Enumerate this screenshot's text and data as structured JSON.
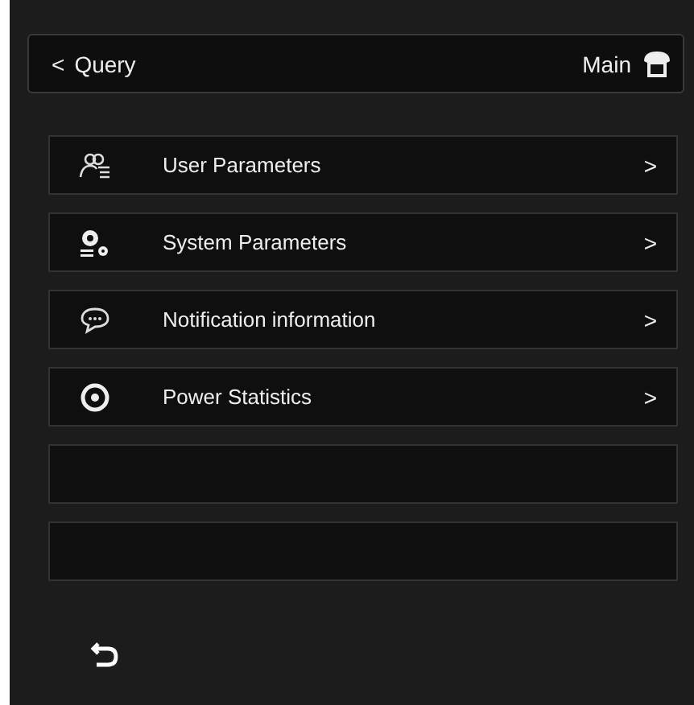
{
  "header": {
    "back_glyph": "<",
    "title": "Query",
    "home_label": "Main"
  },
  "menu": [
    {
      "label": "User Parameters",
      "chevron": ">"
    },
    {
      "label": "System Parameters",
      "chevron": ">"
    },
    {
      "label": "Notification information",
      "chevron": ">"
    },
    {
      "label": "Power Statistics",
      "chevron": ">"
    }
  ]
}
